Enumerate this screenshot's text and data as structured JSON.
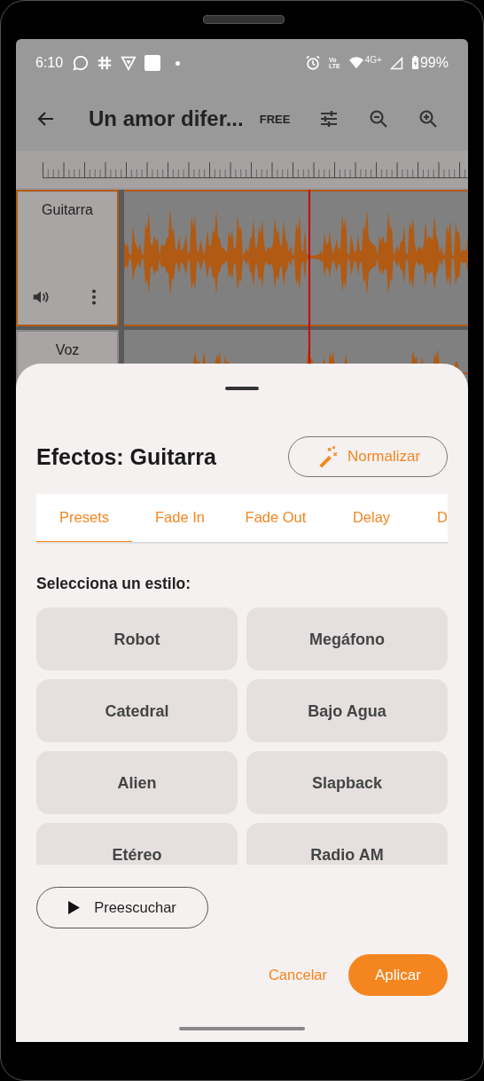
{
  "status_bar": {
    "time": "6:10",
    "volte_top": "Vo",
    "volte_bottom": "LTE",
    "network": "4G+",
    "battery": "99%"
  },
  "toolbar": {
    "title": "Un amor difer...",
    "badge": "FREE"
  },
  "tracks": [
    {
      "name": "Guitarra",
      "selected": true
    },
    {
      "name": "Voz",
      "selected": false
    }
  ],
  "effects_sheet": {
    "title": "Efectos: Guitarra",
    "normalize_button": "Normalizar",
    "tabs": [
      {
        "label": "Presets",
        "selected": true
      },
      {
        "label": "Fade In",
        "selected": false
      },
      {
        "label": "Fade Out",
        "selected": false
      },
      {
        "label": "Delay",
        "selected": false
      },
      {
        "label": "D",
        "selected": false
      }
    ],
    "section_label": "Selecciona un estilo:",
    "presets": [
      {
        "label": "Robot"
      },
      {
        "label": "Megáfono"
      },
      {
        "label": "Catedral"
      },
      {
        "label": "Bajo Agua"
      },
      {
        "label": "Alien"
      },
      {
        "label": "Slapback"
      },
      {
        "label": "Etéreo"
      },
      {
        "label": "Radio AM"
      }
    ],
    "preview_button": "Preescuchar",
    "cancel_button": "Cancelar",
    "apply_button": "Aplicar"
  }
}
